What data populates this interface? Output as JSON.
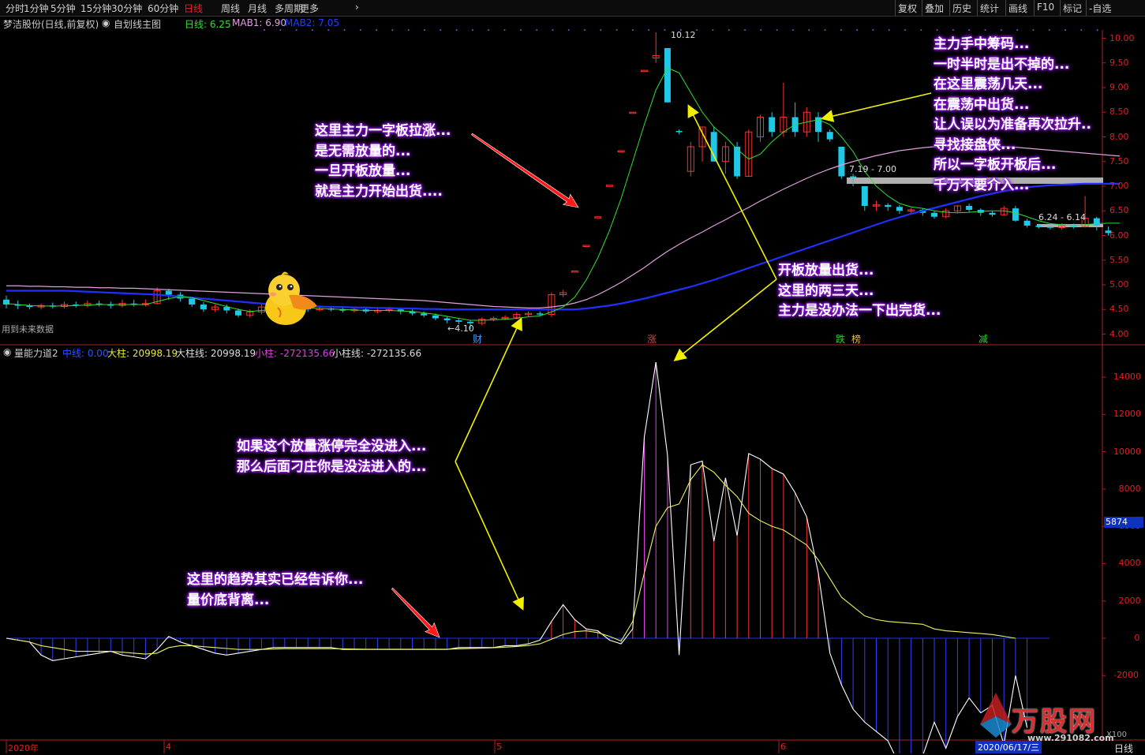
{
  "toolbar": {
    "periods": [
      "分时",
      "1分钟",
      "5分钟",
      "15分钟",
      "30分钟",
      "60分钟",
      "日线",
      "周线",
      "月线",
      "多周期",
      "更多"
    ],
    "active_period": "日线",
    "right_buttons": [
      "复权",
      "叠加",
      "历史",
      "统计",
      "画线",
      "F10",
      "标记",
      "-自选"
    ]
  },
  "main_info": {
    "stock": "梦洁股份(日线,前复权)",
    "indicator": "自划线主图",
    "ma_day": "日线: 6.25",
    "mab1": "MAB1: 6.90",
    "mab2": "MAB2: 7.05"
  },
  "vol_info": {
    "name": "量能力道2",
    "mid": "中线: 0.00",
    "big": "大柱: 20998.19",
    "big_line": "大柱线: 20998.19",
    "small": "小柱: -272135.66",
    "small_line": "小柱线: -272135.66"
  },
  "price_axis": [
    "10.00",
    "9.50",
    "9.00",
    "8.50",
    "8.00",
    "7.50",
    "7.00",
    "6.50",
    "6.00",
    "5.50",
    "5.00",
    "4.50",
    "4.00"
  ],
  "vol_axis": [
    "14000",
    "12000",
    "10000",
    "8000",
    "6000",
    "4000",
    "2000",
    "0",
    "-2000"
  ],
  "vol_current": "5874",
  "price_marks": {
    "high": "10.12",
    "low": "4.10",
    "range1": "7.19 - 7.00",
    "range2": "6.24 - 6.14"
  },
  "future_data": "用到未来数据",
  "event_markers": [
    {
      "label": "财",
      "color": "#3aa0ff"
    },
    {
      "label": "涨",
      "color": "#ff3030"
    },
    {
      "label": "跌",
      "color": "#30d030"
    },
    {
      "label": "榜",
      "color": "#e8c020"
    },
    {
      "label": "减",
      "color": "#30d030"
    }
  ],
  "time_axis": [
    "2020年",
    "4",
    "5",
    "6"
  ],
  "date_box": "2020/06/17/三",
  "period_label": "日线",
  "x100": "X100",
  "annotations": {
    "a1": [
      "这里主力一字板拉涨...",
      "是无需放量的...",
      "一旦开板放量...",
      "就是主力开始出货...."
    ],
    "a2": [
      "主力手中筹码...",
      "一时半时是出不掉的...",
      "在这里震荡几天...",
      "在震荡中出货...",
      "让人误以为准备再次拉升..",
      "寻找接盘侠...",
      "所以一字板开板后...",
      "千万不要介入..."
    ],
    "a3": [
      "开板放量出货...",
      "这里的两三天...",
      "主力是没办法一下出完货..."
    ],
    "a4": [
      "如果这个放量涨停完全没进入...",
      "那么后面刁庄你是没法进入的..."
    ],
    "a5": [
      "这里的趋势其实已经告诉你...",
      "量价底背离..."
    ]
  },
  "watermark": {
    "text": "万股网",
    "url": "www.291082.com"
  },
  "colors": {
    "up": "#ff3030",
    "down": "#20c8e8",
    "ma_fast": "#30e030",
    "mab1": "#e0a0e0",
    "mab2": "#2030ff",
    "vol_pos": "#ff3030",
    "vol_neg": "#3040ff",
    "annotation_glow": "#8a18d8"
  },
  "chart_data": {
    "type": "candlestick",
    "candles": [
      [
        4.7,
        4.6,
        4.78,
        4.52
      ],
      [
        4.6,
        4.58,
        4.68,
        4.5
      ],
      [
        4.58,
        4.55,
        4.62,
        4.5
      ],
      [
        4.55,
        4.58,
        4.62,
        4.5
      ],
      [
        4.58,
        4.56,
        4.64,
        4.52
      ],
      [
        4.56,
        4.6,
        4.66,
        4.52
      ],
      [
        4.6,
        4.58,
        4.66,
        4.54
      ],
      [
        4.58,
        4.62,
        4.68,
        4.54
      ],
      [
        4.62,
        4.6,
        4.68,
        4.56
      ],
      [
        4.6,
        4.58,
        4.66,
        4.52
      ],
      [
        4.58,
        4.62,
        4.7,
        4.54
      ],
      [
        4.62,
        4.6,
        4.7,
        4.56
      ],
      [
        4.6,
        4.62,
        4.7,
        4.56
      ],
      [
        4.62,
        4.88,
        4.95,
        4.6
      ],
      [
        4.88,
        4.8,
        4.92,
        4.7
      ],
      [
        4.8,
        4.72,
        4.85,
        4.66
      ],
      [
        4.72,
        4.6,
        4.76,
        4.55
      ],
      [
        4.6,
        4.5,
        4.65,
        4.45
      ],
      [
        4.5,
        4.55,
        4.6,
        4.45
      ],
      [
        4.55,
        4.48,
        4.6,
        4.42
      ],
      [
        4.48,
        4.38,
        4.52,
        4.34
      ],
      [
        4.38,
        4.45,
        4.5,
        4.34
      ],
      [
        4.45,
        4.55,
        4.6,
        4.4
      ],
      [
        4.55,
        4.58,
        4.65,
        4.5
      ],
      [
        4.58,
        4.52,
        4.62,
        4.48
      ],
      [
        4.52,
        4.55,
        4.6,
        4.48
      ],
      [
        4.55,
        4.5,
        4.6,
        4.45
      ],
      [
        4.5,
        4.52,
        4.58,
        4.46
      ],
      [
        4.52,
        4.5,
        4.56,
        4.46
      ],
      [
        4.5,
        4.48,
        4.55,
        4.44
      ],
      [
        4.48,
        4.5,
        4.55,
        4.44
      ],
      [
        4.5,
        4.46,
        4.54,
        4.42
      ],
      [
        4.46,
        4.48,
        4.52,
        4.42
      ],
      [
        4.48,
        4.5,
        4.55,
        4.44
      ],
      [
        4.5,
        4.46,
        4.54,
        4.4
      ],
      [
        4.46,
        4.42,
        4.5,
        4.38
      ],
      [
        4.42,
        4.38,
        4.46,
        4.34
      ],
      [
        4.38,
        4.32,
        4.42,
        4.28
      ],
      [
        4.32,
        4.28,
        4.36,
        4.22
      ],
      [
        4.28,
        4.25,
        4.32,
        4.2
      ],
      [
        4.25,
        4.22,
        4.28,
        4.1
      ],
      [
        4.22,
        4.3,
        4.34,
        4.18
      ],
      [
        4.3,
        4.32,
        4.36,
        4.26
      ],
      [
        4.32,
        4.34,
        4.38,
        4.28
      ],
      [
        4.34,
        4.4,
        4.44,
        4.3
      ],
      [
        4.4,
        4.42,
        4.46,
        4.36
      ],
      [
        4.42,
        4.4,
        4.46,
        4.36
      ],
      [
        4.4,
        4.8,
        4.85,
        4.35
      ],
      [
        4.8,
        4.84,
        4.9,
        4.75
      ],
      [
        5.28,
        5.28,
        5.28,
        5.28
      ],
      [
        5.8,
        5.8,
        5.8,
        5.8
      ],
      [
        6.38,
        6.38,
        6.38,
        6.38
      ],
      [
        7.02,
        7.02,
        7.02,
        7.02
      ],
      [
        7.72,
        7.72,
        7.72,
        7.72
      ],
      [
        8.5,
        8.5,
        8.5,
        8.5
      ],
      [
        9.35,
        9.35,
        9.35,
        9.35
      ],
      [
        9.6,
        9.65,
        10.12,
        9.5
      ],
      [
        9.8,
        8.7,
        9.8,
        8.7
      ],
      [
        8.12,
        8.1,
        8.15,
        8.05
      ],
      [
        7.3,
        7.8,
        7.9,
        7.2
      ],
      [
        7.8,
        8.2,
        8.2,
        7.5
      ],
      [
        8.1,
        7.5,
        8.2,
        7.5
      ],
      [
        7.5,
        7.8,
        7.9,
        7.25
      ],
      [
        7.8,
        7.2,
        7.9,
        7.15
      ],
      [
        7.2,
        8.1,
        8.15,
        7.2
      ],
      [
        8.0,
        8.4,
        8.45,
        7.9
      ],
      [
        8.4,
        8.1,
        8.5,
        8.0
      ],
      [
        8.1,
        8.4,
        9.1,
        8.0
      ],
      [
        8.4,
        8.1,
        8.7,
        8.0
      ],
      [
        8.1,
        8.5,
        8.6,
        8.0
      ],
      [
        8.4,
        8.1,
        8.5,
        7.9
      ],
      [
        8.1,
        7.95,
        8.15,
        7.9
      ],
      [
        7.8,
        7.2,
        7.8,
        7.15
      ],
      [
        7.2,
        7.19,
        7.25,
        7.0
      ],
      [
        7.0,
        6.6,
        7.0,
        6.5
      ],
      [
        6.6,
        6.62,
        6.7,
        6.5
      ],
      [
        6.62,
        6.58,
        6.66,
        6.5
      ],
      [
        6.58,
        6.5,
        6.62,
        6.44
      ],
      [
        6.5,
        6.52,
        6.56,
        6.45
      ],
      [
        6.52,
        6.46,
        6.55,
        6.4
      ],
      [
        6.46,
        6.38,
        6.5,
        6.34
      ],
      [
        6.38,
        6.5,
        6.55,
        6.35
      ],
      [
        6.5,
        6.6,
        6.62,
        6.45
      ],
      [
        6.6,
        6.52,
        6.65,
        6.48
      ],
      [
        6.52,
        6.46,
        6.55,
        6.4
      ],
      [
        6.46,
        6.42,
        6.5,
        6.38
      ],
      [
        6.42,
        6.55,
        6.6,
        6.4
      ],
      [
        6.55,
        6.3,
        6.6,
        6.28
      ],
      [
        6.3,
        6.2,
        6.34,
        6.16
      ],
      [
        6.2,
        6.18,
        6.24,
        6.14
      ],
      [
        6.18,
        6.16,
        6.22,
        6.12
      ],
      [
        6.16,
        6.2,
        6.25,
        6.12
      ],
      [
        6.2,
        6.18,
        6.24,
        6.14
      ],
      [
        6.18,
        6.35,
        6.8,
        6.16
      ],
      [
        6.35,
        6.2,
        6.38,
        6.1
      ],
      [
        6.1,
        6.05,
        6.18,
        6.0
      ]
    ],
    "mab1": [
      4.98,
      4.98,
      4.97,
      4.97,
      4.96,
      4.96,
      4.95,
      4.95,
      4.94,
      4.94,
      4.93,
      4.93,
      4.92,
      4.91,
      4.9,
      4.89,
      4.88,
      4.87,
      4.86,
      4.85,
      4.84,
      4.83,
      4.82,
      4.81,
      4.8,
      4.79,
      4.78,
      4.77,
      4.76,
      4.75,
      4.74,
      4.73,
      4.72,
      4.71,
      4.7,
      4.69,
      4.68,
      4.66,
      4.64,
      4.62,
      4.6,
      4.58,
      4.56,
      4.55,
      4.54,
      4.53,
      4.53,
      4.55,
      4.58,
      4.63,
      4.7,
      4.8,
      4.92,
      5.05,
      5.2,
      5.35,
      5.52,
      5.68,
      5.82,
      5.95,
      6.07,
      6.2,
      6.32,
      6.45,
      6.57,
      6.7,
      6.82,
      6.94,
      7.05,
      7.16,
      7.26,
      7.35,
      7.43,
      7.5,
      7.56,
      7.62,
      7.67,
      7.72,
      7.75,
      7.78,
      7.8,
      7.81,
      7.82,
      7.82,
      7.82,
      7.81,
      7.8,
      7.79,
      7.77,
      7.75,
      7.73,
      7.71,
      7.69,
      7.67,
      7.65,
      7.63,
      7.61
    ],
    "mab2": [
      4.88,
      4.88,
      4.88,
      4.88,
      4.88,
      4.88,
      4.87,
      4.86,
      4.85,
      4.84,
      4.83,
      4.82,
      4.81,
      4.8,
      4.78,
      4.76,
      4.74,
      4.72,
      4.7,
      4.68,
      4.66,
      4.64,
      4.62,
      4.6,
      4.59,
      4.58,
      4.57,
      4.56,
      4.55,
      4.55,
      4.54,
      4.54,
      4.53,
      4.53,
      4.52,
      4.52,
      4.51,
      4.51,
      4.5,
      4.5,
      4.5,
      4.5,
      4.5,
      4.5,
      4.5,
      4.5,
      4.5,
      4.5,
      4.5,
      4.5,
      4.52,
      4.55,
      4.58,
      4.62,
      4.67,
      4.72,
      4.78,
      4.84,
      4.9,
      4.96,
      5.03,
      5.1,
      5.18,
      5.26,
      5.34,
      5.42,
      5.5,
      5.58,
      5.66,
      5.74,
      5.82,
      5.9,
      5.98,
      6.06,
      6.14,
      6.22,
      6.3,
      6.37,
      6.44,
      6.5,
      6.56,
      6.62,
      6.68,
      6.74,
      6.8,
      6.85,
      6.9,
      6.94,
      6.98,
      7.0,
      7.02,
      7.03,
      7.04,
      7.05,
      7.05,
      7.05,
      7.05
    ],
    "ma_fast": [
      4.62,
      4.6,
      4.58,
      4.57,
      4.57,
      4.57,
      4.58,
      4.59,
      4.6,
      4.6,
      4.6,
      4.6,
      4.6,
      4.66,
      4.72,
      4.76,
      4.74,
      4.68,
      4.62,
      4.56,
      4.5,
      4.46,
      4.48,
      4.5,
      4.52,
      4.53,
      4.53,
      4.52,
      4.51,
      4.5,
      4.49,
      4.48,
      4.48,
      4.48,
      4.47,
      4.46,
      4.43,
      4.4,
      4.36,
      4.32,
      4.28,
      4.28,
      4.29,
      4.3,
      4.32,
      4.35,
      4.37,
      4.45,
      4.55,
      4.75,
      5.1,
      5.55,
      6.1,
      6.75,
      7.5,
      8.25,
      8.95,
      9.4,
      9.3,
      8.9,
      8.5,
      8.2,
      8.0,
      7.75,
      7.55,
      7.65,
      7.9,
      8.1,
      8.25,
      8.3,
      8.35,
      8.25,
      8.0,
      7.7,
      7.3,
      7.0,
      6.8,
      6.65,
      6.58,
      6.55,
      6.5,
      6.47,
      6.46,
      6.47,
      6.49,
      6.5,
      6.5,
      6.46,
      6.38,
      6.3,
      6.24,
      6.22,
      6.2,
      6.22,
      6.24,
      6.25,
      6.25
    ],
    "vol_line": [
      0,
      -100,
      -200,
      -900,
      -1200,
      -1100,
      -1000,
      -900,
      -800,
      -700,
      -900,
      -1000,
      -1100,
      -600,
      100,
      -200,
      -400,
      -600,
      -800,
      -900,
      -800,
      -700,
      -600,
      -500,
      -500,
      -500,
      -500,
      -500,
      -500,
      -600,
      -600,
      -600,
      -600,
      -600,
      -600,
      -600,
      -600,
      -600,
      -600,
      -500,
      -500,
      -500,
      -500,
      -400,
      -400,
      -300,
      -100,
      900,
      1800,
      1000,
      500,
      400,
      -100,
      -300,
      500,
      10800,
      14800,
      9800,
      -900,
      9300,
      9500,
      5200,
      8600,
      5500,
      9900,
      9600,
      9100,
      8800,
      7800,
      6500,
      3500,
      -800,
      -2500,
      -3800,
      -4500,
      -5000,
      -5500,
      -6800,
      -7000,
      -6300,
      -4500,
      -5900,
      -4200,
      -3200,
      -4000,
      -3600,
      -5700,
      -2000,
      -4800
    ],
    "vol_smooth": [
      0,
      -100,
      -200,
      -400,
      -500,
      -600,
      -700,
      -700,
      -700,
      -700,
      -750,
      -800,
      -850,
      -800,
      -500,
      -400,
      -400,
      -450,
      -500,
      -550,
      -600,
      -600,
      -600,
      -580,
      -560,
      -560,
      -560,
      -560,
      -560,
      -570,
      -580,
      -590,
      -590,
      -590,
      -590,
      -590,
      -590,
      -590,
      -590,
      -570,
      -550,
      -530,
      -510,
      -480,
      -440,
      -390,
      -300,
      -50,
      200,
      350,
      400,
      300,
      100,
      -150,
      900,
      3500,
      6000,
      7000,
      7200,
      8500,
      9300,
      8900,
      8200,
      7600,
      6700,
      6300,
      6000,
      5800,
      5400,
      5000,
      4200,
      3200,
      2200,
      1700,
      1200,
      1000,
      900,
      850,
      800,
      750,
      500,
      400,
      350,
      300,
      250,
      200,
      100,
      0
    ]
  }
}
